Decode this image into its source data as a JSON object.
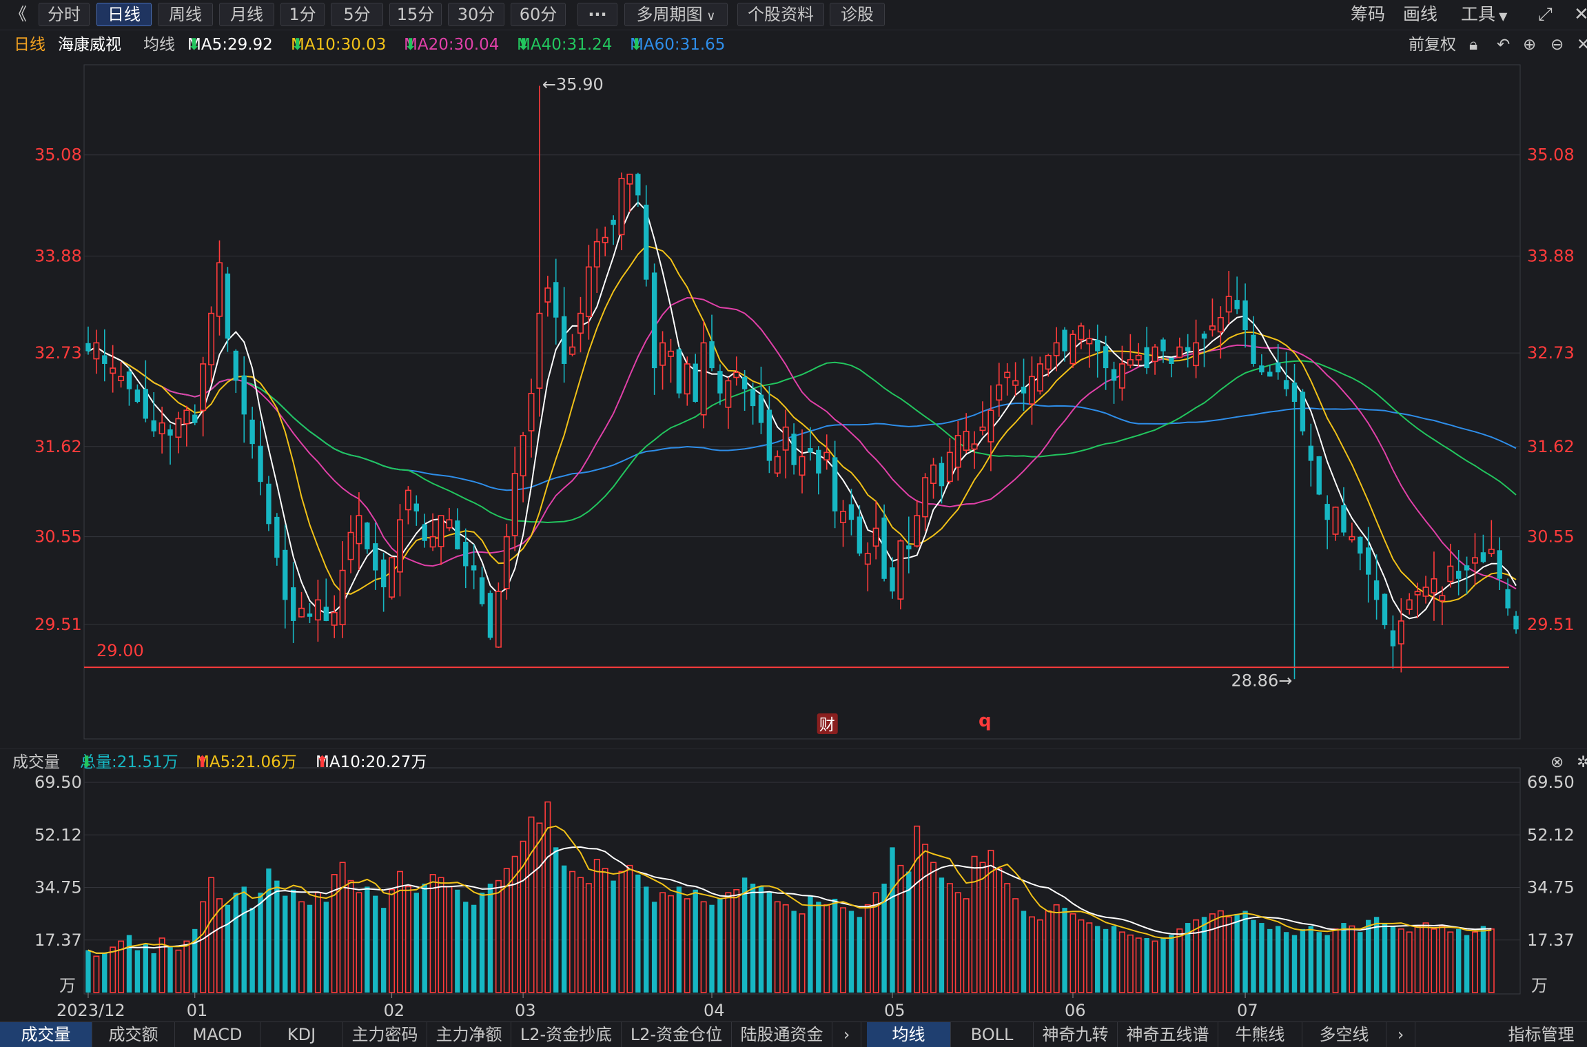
{
  "toolbar": {
    "back_label": "《",
    "periods": [
      "分时",
      "日线",
      "周线",
      "月线",
      "1分",
      "5分",
      "15分",
      "30分",
      "60分"
    ],
    "active_period": "日线",
    "more_label": "···",
    "multi_period_label": "多周期图",
    "profile_label": "个股资料",
    "diagnose_label": "诊股",
    "chips_label": "筹码",
    "draw_label": "画线",
    "tools_label": "工具"
  },
  "legend": {
    "period": "日线",
    "stock_name": "海康威视",
    "avg_label": "均线",
    "ma5": "MA5:29.92",
    "ma10": "MA10:30.03",
    "ma20": "MA20:30.04",
    "ma40": "MA40:31.24",
    "ma60": "MA60:31.65",
    "adjust_label": "前复权"
  },
  "colors": {
    "up": "#ff3b3b",
    "down": "#17b7c3",
    "ma5": "#ffffff",
    "ma10": "#f2c218",
    "ma20": "#e040a8",
    "ma40": "#22c55e",
    "ma60": "#2e8de8",
    "background": "#1b1c20",
    "grid": "#34353b"
  },
  "chart_data": [
    {
      "type": "candlestick",
      "title": "海康威视 日线",
      "ylim": [
        28.2,
        36.1
      ],
      "y_ticks": [
        "35.08",
        "33.88",
        "32.73",
        "31.62",
        "30.55",
        "29.51"
      ],
      "y_tick_values": [
        35.08,
        33.88,
        32.73,
        31.62,
        30.55,
        29.51
      ],
      "x_tick_labels": [
        "2023/12",
        "01",
        "02",
        "03",
        "04",
        "05",
        "06",
        "07"
      ],
      "x_tick_index": [
        0,
        13,
        37,
        53,
        76,
        98,
        120,
        141
      ],
      "annotations": {
        "high_label": "←35.90",
        "high_value": 35.9,
        "high_index": 55,
        "low_label": "28.86→",
        "low_value": 28.86,
        "low_index": 147,
        "support_label": "29.00",
        "support_value": 29.0,
        "event_marker": "财",
        "event_marker_index": 90,
        "event_q": "q",
        "event_q_index": 109
      },
      "closes": [
        32.75,
        32.85,
        32.6,
        32.55,
        32.45,
        32.3,
        32.15,
        31.95,
        31.8,
        31.9,
        31.75,
        31.95,
        32.05,
        31.9,
        32.6,
        33.2,
        33.8,
        32.9,
        32.4,
        32.0,
        31.65,
        31.2,
        30.7,
        30.3,
        29.8,
        29.55,
        29.7,
        29.6,
        29.8,
        29.55,
        29.65,
        30.15,
        30.6,
        30.8,
        30.4,
        30.15,
        29.95,
        30.3,
        30.75,
        31.1,
        30.85,
        30.5,
        30.55,
        30.8,
        30.75,
        30.4,
        30.2,
        30.15,
        29.75,
        29.35,
        29.9,
        30.55,
        31.3,
        31.75,
        32.25,
        33.2,
        33.5,
        33.15,
        32.6,
        32.8,
        33.2,
        33.75,
        34.05,
        34.1,
        34.25,
        34.8,
        34.85,
        34.6,
        33.6,
        32.55,
        32.85,
        32.75,
        32.25,
        32.6,
        32.15,
        32.85,
        32.55,
        32.25,
        32.4,
        32.5,
        32.3,
        32.1,
        31.9,
        31.45,
        31.5,
        31.85,
        31.4,
        31.5,
        31.55,
        31.3,
        31.55,
        30.85,
        30.85,
        30.75,
        30.35,
        30.35,
        30.65,
        30.05,
        29.9,
        30.5,
        30.4,
        30.8,
        31.25,
        31.4,
        31.15,
        31.55,
        31.75,
        31.8,
        31.65,
        31.85,
        32.05,
        32.35,
        32.5,
        32.4,
        32.25,
        32.45,
        32.6,
        32.7,
        32.85,
        32.75,
        32.95,
        33.05,
        32.9,
        32.75,
        32.55,
        32.4,
        32.6,
        32.65,
        32.7,
        32.55,
        32.8,
        32.75,
        32.6,
        32.8,
        32.75,
        32.85,
        32.9,
        33.05,
        33.15,
        33.4,
        33.25,
        33.0,
        32.6,
        32.5,
        32.45,
        32.5,
        32.3,
        32.15,
        31.8,
        31.45,
        31.05,
        30.75,
        30.9,
        30.6,
        30.55,
        30.35,
        30.1,
        29.8,
        29.5,
        29.25,
        29.55,
        29.8,
        29.9,
        29.95,
        30.05,
        29.85,
        30.2,
        30.05,
        30.15,
        30.3,
        30.25,
        30.4,
        30.05,
        29.7,
        29.45
      ]
    },
    {
      "type": "bar",
      "title": "成交量",
      "unit": "万",
      "ylim": [
        0,
        72
      ],
      "y_ticks": [
        "69.50",
        "52.12",
        "34.75",
        "17.37"
      ],
      "y_tick_values": [
        69.5,
        52.12,
        34.75,
        17.37
      ],
      "total": "总量:21.51万",
      "ma5": "MA5:21.06万",
      "ma10": "MA10:20.27万",
      "values": [
        14,
        12,
        13,
        15,
        17,
        19,
        14,
        16,
        13,
        18,
        15,
        14,
        17,
        21,
        30,
        38,
        31,
        29,
        33,
        35,
        28,
        33,
        41,
        37,
        32,
        34,
        30,
        29,
        33,
        30,
        39,
        43,
        37,
        33,
        35,
        32,
        28,
        34,
        40,
        35,
        33,
        36,
        39,
        38,
        35,
        34,
        30,
        29,
        33,
        36,
        37,
        41,
        45,
        50,
        58,
        56,
        63,
        48,
        42,
        40,
        38,
        36,
        44,
        41,
        37,
        40,
        42,
        39,
        35,
        30,
        33,
        32,
        35,
        31,
        34,
        30,
        29,
        31,
        33,
        34,
        38,
        36,
        35,
        33,
        30,
        29,
        27,
        26,
        32,
        30,
        29,
        31,
        28,
        27,
        25,
        29,
        33,
        36,
        48,
        42,
        40,
        55,
        49,
        43,
        38,
        36,
        33,
        31,
        45,
        43,
        47,
        41,
        36,
        31,
        27,
        25,
        24,
        27,
        29,
        28,
        26,
        24,
        23,
        22,
        21,
        22,
        20,
        19,
        18,
        18,
        17,
        18,
        19,
        21,
        23,
        24,
        25,
        26,
        27,
        25,
        26,
        27,
        24,
        23,
        21,
        22,
        20,
        19,
        21,
        22,
        20,
        19,
        21,
        23,
        22,
        20,
        24,
        25,
        23,
        22,
        21,
        20,
        22,
        23,
        21,
        22,
        20,
        21,
        19,
        20,
        22,
        21
      ]
    }
  ],
  "volume_legend": {
    "title": "成交量",
    "total": "总量:21.51万",
    "ma5": "MA5:21.06万",
    "ma10": "MA10:20.27万"
  },
  "bottom_tabs": [
    "成交量",
    "成交额",
    "MACD",
    "KDJ",
    "主力密码",
    "主力净额",
    "L2-资金抄底",
    "L2-资金仓位",
    "陆股通资金"
  ],
  "bottom_tabs_right": [
    "均线",
    "BOLL",
    "神奇九转",
    "神奇五线谱",
    "牛熊线",
    "多空线"
  ],
  "active_tab": "成交量",
  "active_tab_right": "均线",
  "indicator_manage": "指标管理"
}
